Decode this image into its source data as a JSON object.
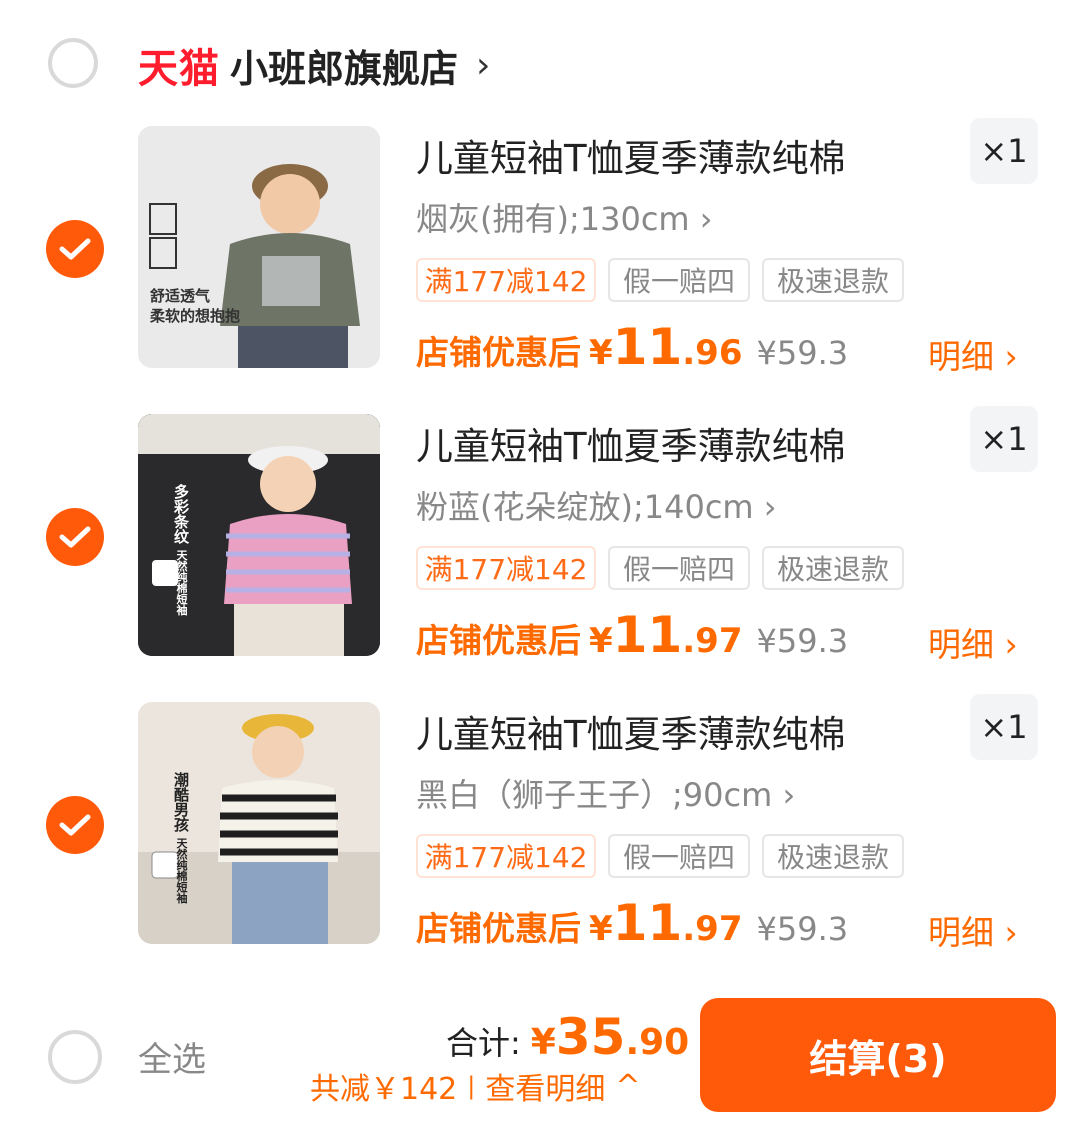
{
  "shop": {
    "brand": "天猫",
    "name": "小班郎旗舰店",
    "arrow": "›"
  },
  "items": [
    {
      "title": "儿童短袖T恤夏季薄款纯棉",
      "spec": "烟灰(拥有);130cm ›",
      "qty": "×1",
      "tags": [
        "满177减142",
        "假一赔四",
        "极速退款"
      ],
      "price_label": "店铺优惠后",
      "price_yen": "¥",
      "price_int": "11",
      "price_dec": ".96",
      "price_orig": "¥59.3",
      "detail": "明细 ›",
      "image_text": [
        "舒适透气",
        "柔软的想抱抱"
      ]
    },
    {
      "title": "儿童短袖T恤夏季薄款纯棉",
      "spec": "粉蓝(花朵绽放);140cm ›",
      "qty": "×1",
      "tags": [
        "满177减142",
        "假一赔四",
        "极速退款"
      ],
      "price_label": "店铺优惠后",
      "price_yen": "¥",
      "price_int": "11",
      "price_dec": ".97",
      "price_orig": "¥59.3",
      "detail": "明细 ›",
      "image_text": [
        "多彩条纹",
        "天然纯棉短袖"
      ]
    },
    {
      "title": "儿童短袖T恤夏季薄款纯棉",
      "spec": "黑白（狮子王子）;90cm ›",
      "qty": "×1",
      "tags": [
        "满177减142",
        "假一赔四",
        "极速退款"
      ],
      "price_label": "店铺优惠后",
      "price_yen": "¥",
      "price_int": "11",
      "price_dec": ".97",
      "price_orig": "¥59.3",
      "detail": "明细 ›",
      "image_text": [
        "潮酷男孩",
        "天然纯棉短袖"
      ]
    }
  ],
  "footer": {
    "select_all": "全选",
    "total_label": "合计:",
    "total_yen": "¥",
    "total_int": "35",
    "total_dec": ".90",
    "discount": "共减￥142",
    "divider": "|",
    "view_detail": "查看明细",
    "caret": "^",
    "checkout": "结算(3)"
  },
  "colors": {
    "accent": "#ff5a0a",
    "tmall": "#ff1d2d",
    "muted": "#888888"
  }
}
